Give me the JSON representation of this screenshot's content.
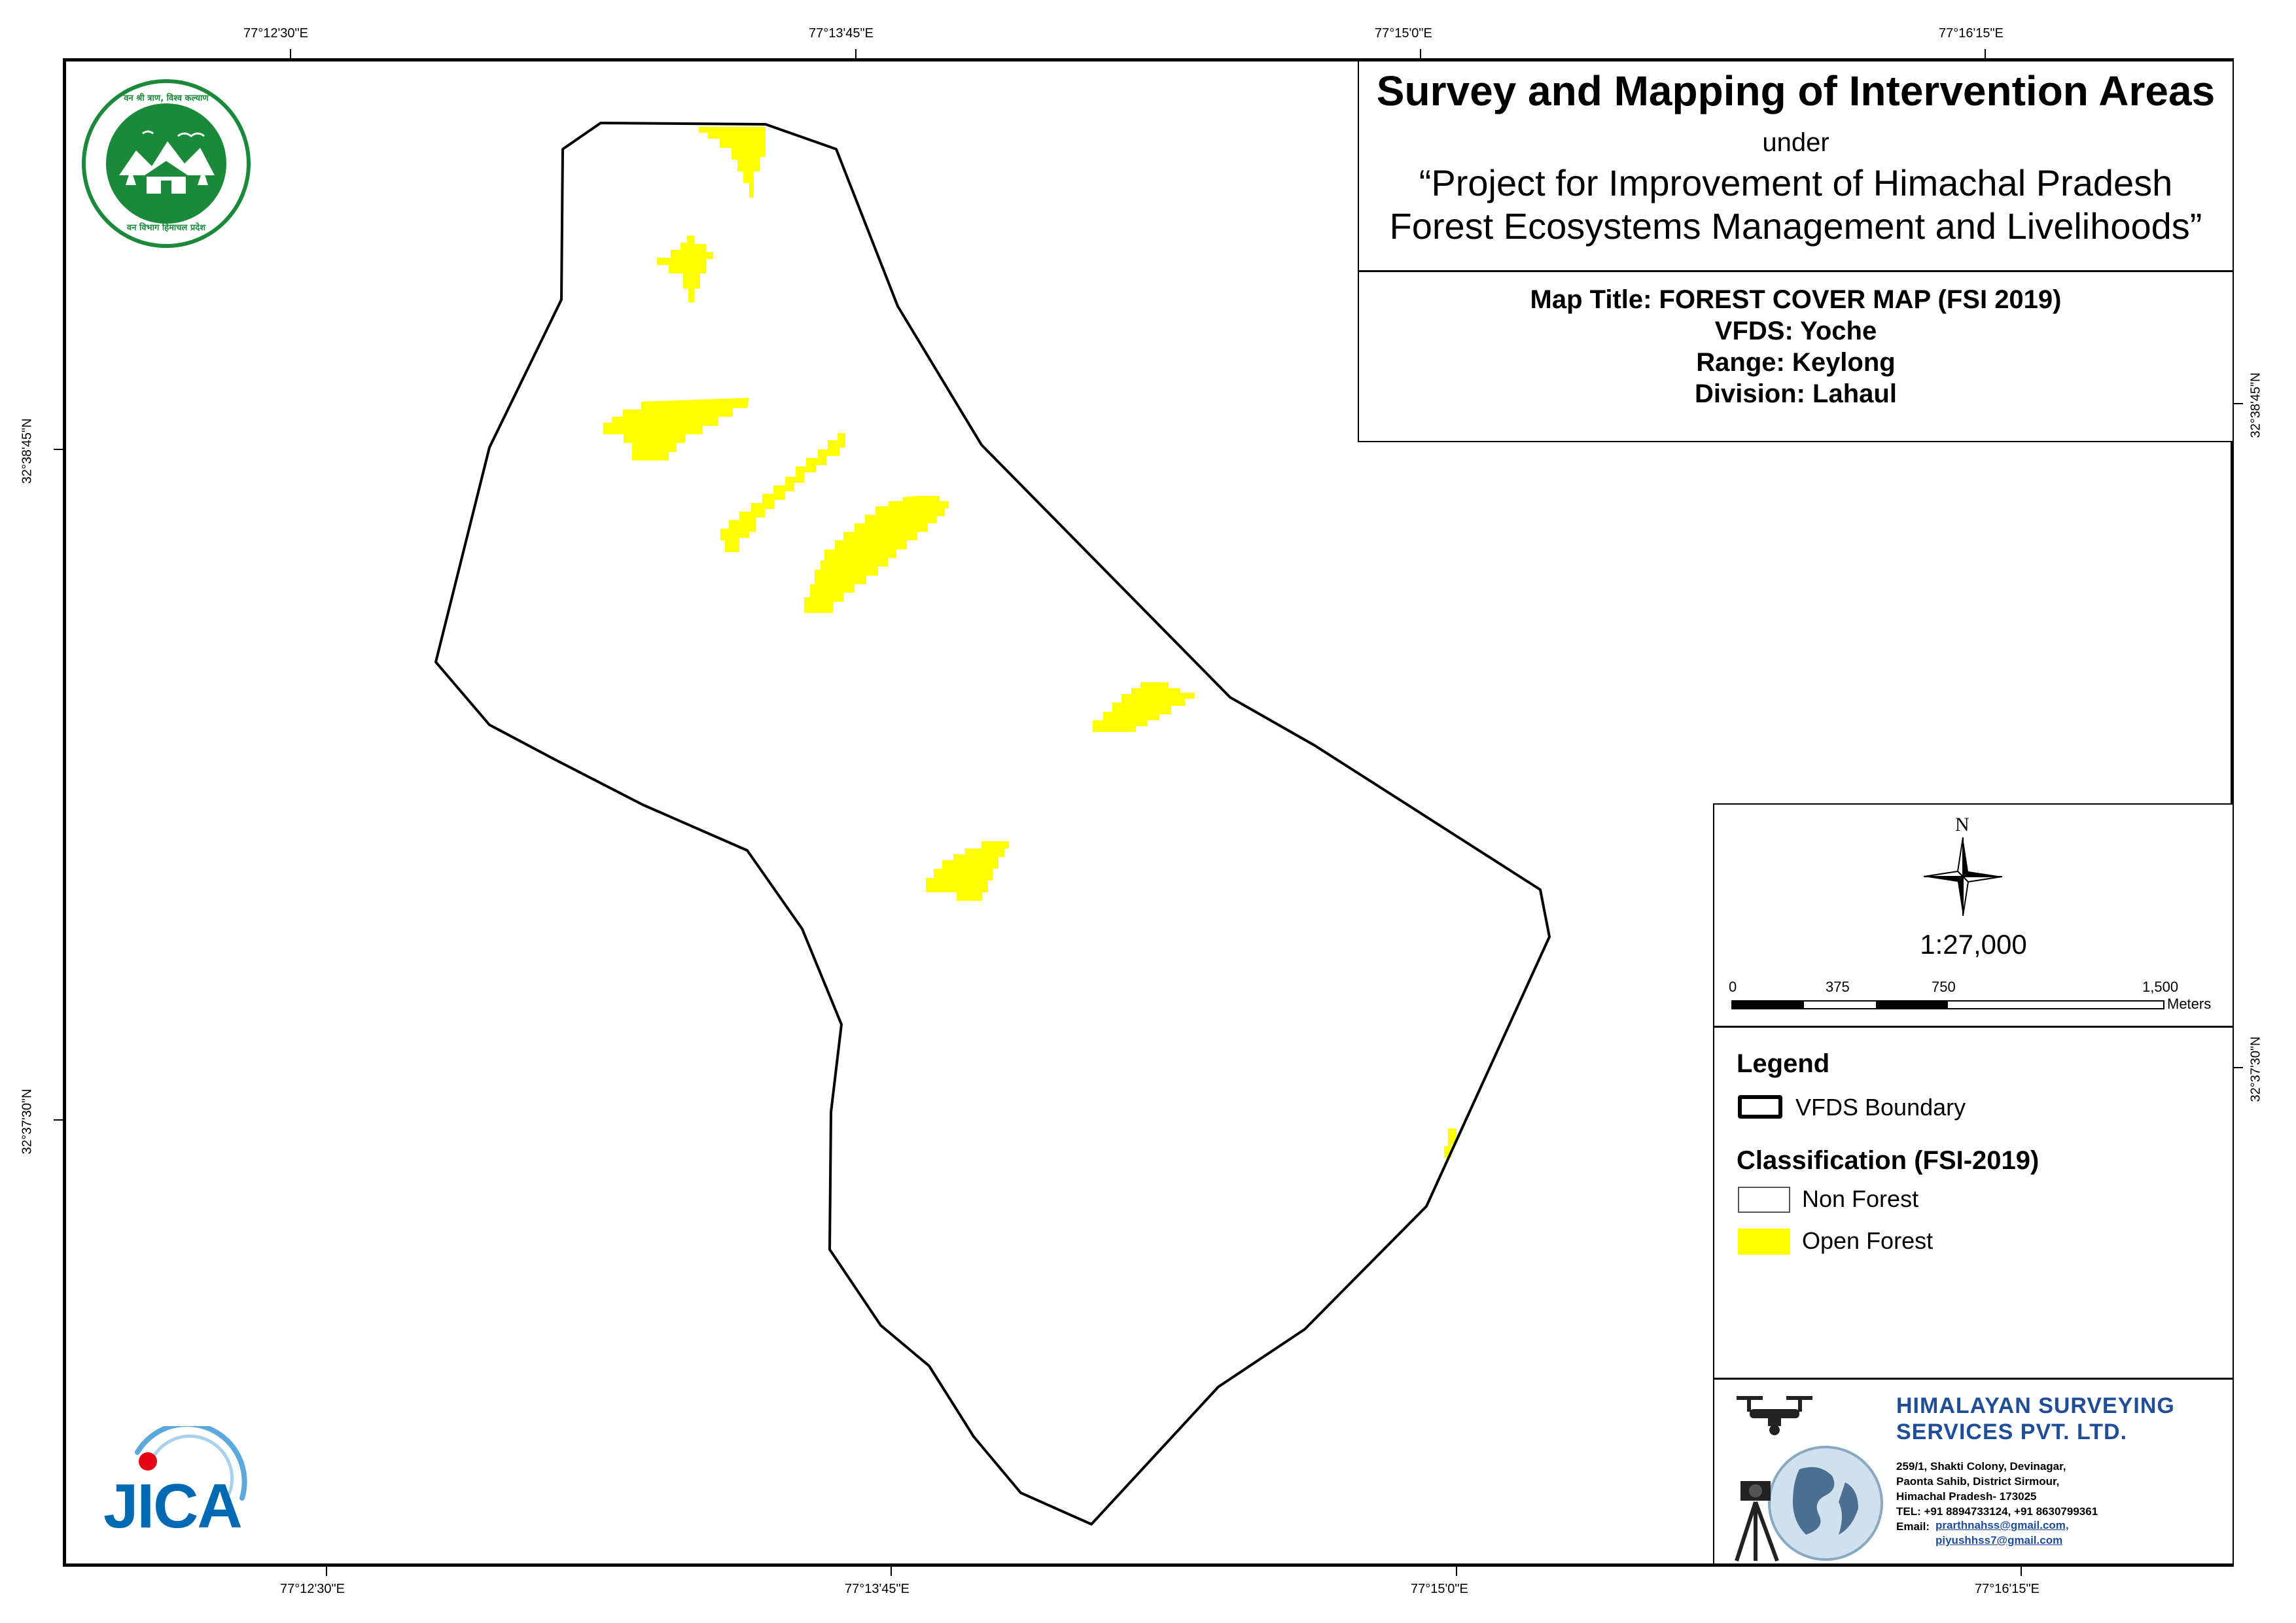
{
  "graticule": {
    "top": [
      "77°12'30\"E",
      "77°13'45\"E",
      "77°15'0\"E",
      "77°16'15\"E"
    ],
    "bottom": [
      "77°12'30\"E",
      "77°13'45\"E",
      "77°15'0\"E",
      "77°16'15\"E"
    ],
    "left": [
      "32°38'45\"N",
      "32°37'30\"N"
    ],
    "right": [
      "32°38'45\"N",
      "32°37'30\"N"
    ]
  },
  "title_block": {
    "main": "Survey and Mapping of Intervention Areas",
    "under": "under",
    "project_line1": "“Project for Improvement of Himachal Pradesh",
    "project_line2": "Forest Ecosystems Management and Livelihoods”",
    "map_title": "Map Title: FOREST COVER MAP (FSI 2019)",
    "vfds": "VFDS: Yoche",
    "range": "Range: Keylong",
    "division": "Division: Lahaul"
  },
  "north_arrow": {
    "label": "N"
  },
  "scale": {
    "ratio": "1:27,000",
    "ticks": [
      "0",
      "375",
      "750",
      "1,500"
    ],
    "unit": "Meters"
  },
  "legend": {
    "heading": "Legend",
    "boundary_label": "VFDS Boundary",
    "classification_heading": "Classification (FSI-2019)",
    "non_forest": "Non Forest",
    "open_forest": "Open Forest",
    "colors": {
      "open_forest": "#ffff00",
      "non_forest": "#ffffff",
      "boundary": "#000000"
    }
  },
  "company": {
    "name_line1": "HIMALAYAN SURVEYING",
    "name_line2": "SERVICES PVT. LTD.",
    "address_lines": [
      "259/1, Shakti Colony, Devinagar,",
      "Paonta Sahib, District Sirmour,",
      "Himachal Pradesh- 173025",
      "TEL: +91 8894733124, +91 8630799361"
    ],
    "email_label": "Email:",
    "email1": "prarthnahss@gmail.com,",
    "email2": "piyushhss7@gmail.com",
    "brand_color": "#1f4e97"
  },
  "logos": {
    "forest_dept_icon": "himachal-forest-department-seal",
    "jica_text": "JICA",
    "forest_dept_text_top": "वन श्री त्राण, विश्व कल्याण",
    "forest_dept_text_bottom": "वन विभाग हिमाचल प्रदेश"
  }
}
